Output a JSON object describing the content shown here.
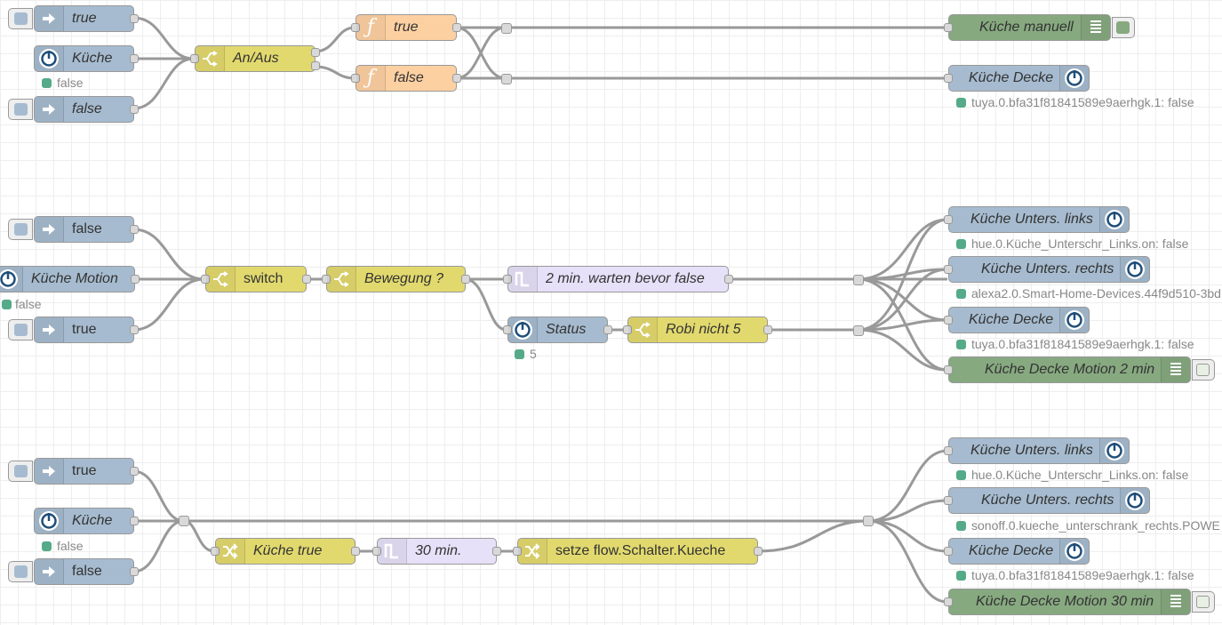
{
  "flows": [
    {
      "inputs": [
        {
          "label": "true"
        },
        {
          "label": "Küche",
          "status": "false"
        },
        {
          "label": "false"
        }
      ],
      "switch": {
        "label": "An/Aus"
      },
      "functions": [
        {
          "label": "true"
        },
        {
          "label": "false"
        }
      ],
      "outputs": [
        {
          "label": "Küche manuell",
          "type": "debug"
        },
        {
          "label": "Küche Decke",
          "type": "iobroker-out",
          "status": "tuya.0.bfa31f81841589e9aerhgk.1: false"
        }
      ]
    },
    {
      "inputs": [
        {
          "label": "false"
        },
        {
          "label": "Küche Motion",
          "status": "false"
        },
        {
          "label": "true"
        }
      ],
      "switch": {
        "label": "switch"
      },
      "switch2": {
        "label": "Bewegung ?"
      },
      "trigger": {
        "label": "2 min. warten bevor false"
      },
      "status_node": {
        "label": "Status",
        "status": "5"
      },
      "switch3": {
        "label": "Robi nicht 5"
      },
      "outputs": [
        {
          "label": "Küche Unters. links",
          "status": "hue.0.Küche_Unterschr_Links.on: false"
        },
        {
          "label": "Küche Unters. rechts",
          "status": "alexa2.0.Smart-Home-Devices.44f9d510-3bd"
        },
        {
          "label": "Küche Decke",
          "status": "tuya.0.bfa31f81841589e9aerhgk.1: false"
        },
        {
          "label": "Küche Decke Motion 2 min",
          "type": "debug"
        }
      ]
    },
    {
      "inputs": [
        {
          "label": "true"
        },
        {
          "label": "Küche",
          "status": "false"
        },
        {
          "label": "false"
        }
      ],
      "change1": {
        "label": "Küche true"
      },
      "trigger": {
        "label": "30 min."
      },
      "change2": {
        "label": "setze flow.Schalter.Kueche"
      },
      "outputs": [
        {
          "label": "Küche Unters. links",
          "status": "hue.0.Küche_Unterschr_Links.on: false"
        },
        {
          "label": "Küche Unters. rechts",
          "status": "sonoff.0.kueche_unterschrank_rechts.POWE"
        },
        {
          "label": "Küche Decke",
          "status": "tuya.0.bfa31f81841589e9aerhgk.1: false"
        },
        {
          "label": "Küche Decke Motion 30 min",
          "type": "debug"
        }
      ]
    }
  ],
  "colors": {
    "inject": "#a6bbcf",
    "switch": "#e2d96e",
    "function": "#fdd0a2",
    "trigger": "#e6e0f8",
    "debug": "#87a980",
    "wire": "#999999",
    "status_dot": "#55aa88"
  },
  "icons": {
    "inject": "arrow-right-icon",
    "iobroker": "power-icon",
    "switch": "switch-icon",
    "function": "function-icon",
    "trigger": "trigger-icon",
    "change": "shuffle-icon",
    "debug": "debug-list-icon"
  }
}
